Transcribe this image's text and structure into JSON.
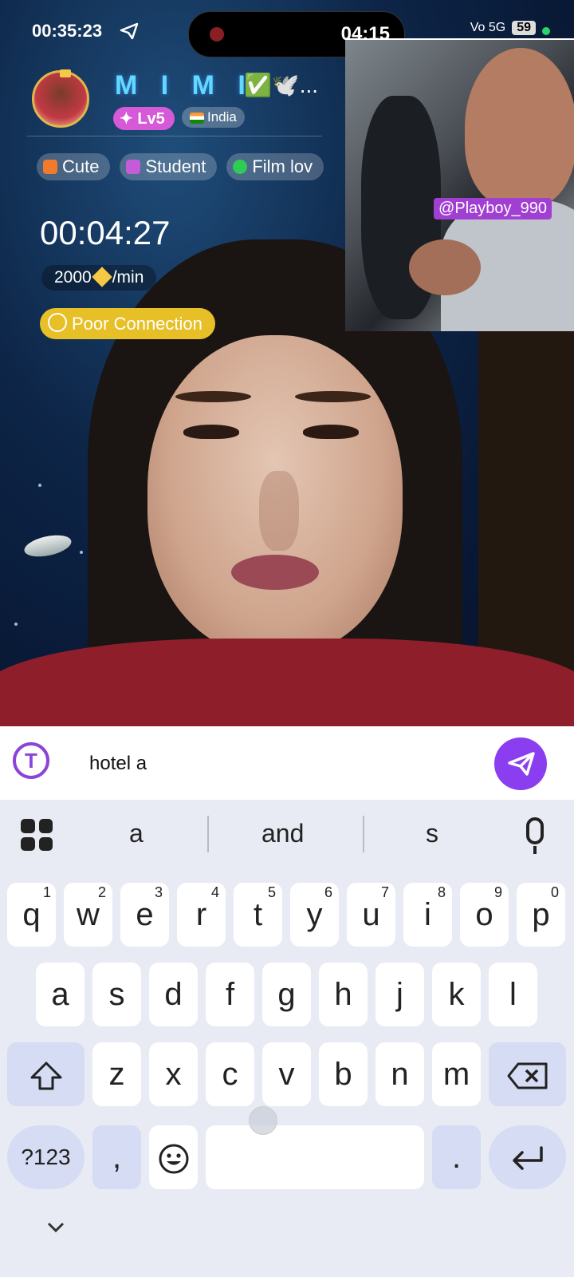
{
  "status_bar": {
    "time": "00:35:23",
    "record_time": "04:15",
    "network": "Vo 5G",
    "battery": "59"
  },
  "profile": {
    "name": "M I M I",
    "name_suffix": "✅🕊️...",
    "level": "Lv5",
    "country": "India",
    "tags": [
      "Cute",
      "Student",
      "Film lov"
    ],
    "tag_colors": [
      "#f07b2c",
      "#c65bd8",
      "#2fcb55"
    ]
  },
  "call": {
    "timer": "00:04:27",
    "rate_amount": "2000",
    "rate_unit": "/min",
    "connection": "Poor Connection"
  },
  "pip": {
    "username": "@Playboy_990"
  },
  "composer": {
    "value": "hotel a",
    "logo_letter": "T"
  },
  "keyboard": {
    "suggestions": [
      "a",
      "and",
      "s"
    ],
    "row1": [
      "q",
      "w",
      "e",
      "r",
      "t",
      "y",
      "u",
      "i",
      "o",
      "p"
    ],
    "row1_nums": [
      "1",
      "2",
      "3",
      "4",
      "5",
      "6",
      "7",
      "8",
      "9",
      "0"
    ],
    "row2": [
      "a",
      "s",
      "d",
      "f",
      "g",
      "h",
      "j",
      "k",
      "l"
    ],
    "row3": [
      "z",
      "x",
      "c",
      "v",
      "b",
      "n",
      "m"
    ],
    "symbols_label": "?123",
    "comma": ",",
    "period": "."
  },
  "colors": {
    "accent": "#8b3df0",
    "connection_badge": "#e7bf27",
    "level_badge": "#d65ad8"
  }
}
